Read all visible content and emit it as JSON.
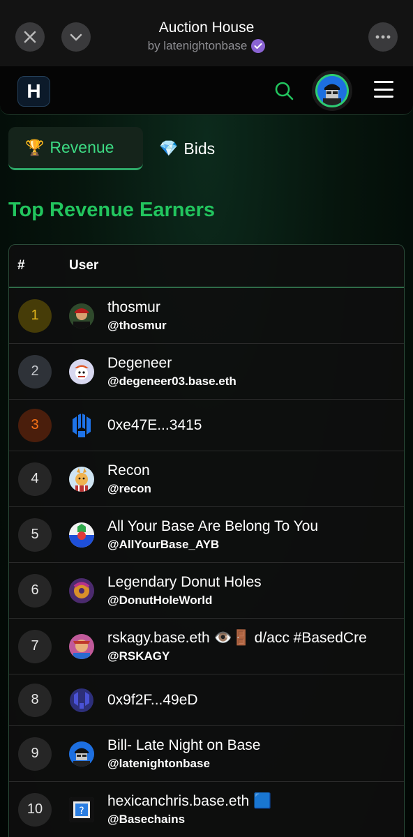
{
  "miniapp": {
    "title": "Auction House",
    "subtitle": "by latenightonbase",
    "icons": {
      "close": "close-icon",
      "collapse": "chevron-down-icon",
      "more": "more-icon",
      "verified": "verified-badge-icon"
    }
  },
  "navbar": {
    "logo_letter": "H",
    "icons": {
      "search": "search-icon",
      "menu": "hamburger-menu-icon"
    }
  },
  "tabs": [
    {
      "emoji": "🏆",
      "label": "Revenue",
      "active": true
    },
    {
      "emoji": "💎",
      "label": "Bids",
      "active": false
    }
  ],
  "section_title": "Top Revenue Earners",
  "table": {
    "headers": {
      "rank": "#",
      "user": "User"
    },
    "rows": [
      {
        "rank": "1",
        "name": "thosmur",
        "handle": "@thosmur"
      },
      {
        "rank": "2",
        "name": "Degeneer",
        "handle": "@degeneer03.base.eth"
      },
      {
        "rank": "3",
        "name": "0xe47E...3415",
        "handle": ""
      },
      {
        "rank": "4",
        "name": "Recon",
        "handle": "@recon"
      },
      {
        "rank": "5",
        "name": "All Your Base Are Belong To You",
        "handle": "@AllYourBase_AYB"
      },
      {
        "rank": "6",
        "name": "Legendary Donut Holes",
        "handle": "@DonutHoleWorld"
      },
      {
        "rank": "7",
        "name": "rskagy.base.eth 👁️🚪 d/acc #BasedCre",
        "handle": "@RSKAGY"
      },
      {
        "rank": "8",
        "name": "0x9f2F...49eD",
        "handle": ""
      },
      {
        "rank": "9",
        "name": "Bill- Late Night on Base",
        "handle": "@latenightonbase"
      },
      {
        "rank": "10",
        "name": "hexicanchris.base.eth 🟦",
        "handle": "@Basechains"
      }
    ]
  },
  "colors": {
    "accent_green": "#22c55e",
    "gold": "#e2b51a",
    "silver": "#c6c9ce",
    "bronze": "#f97316"
  }
}
